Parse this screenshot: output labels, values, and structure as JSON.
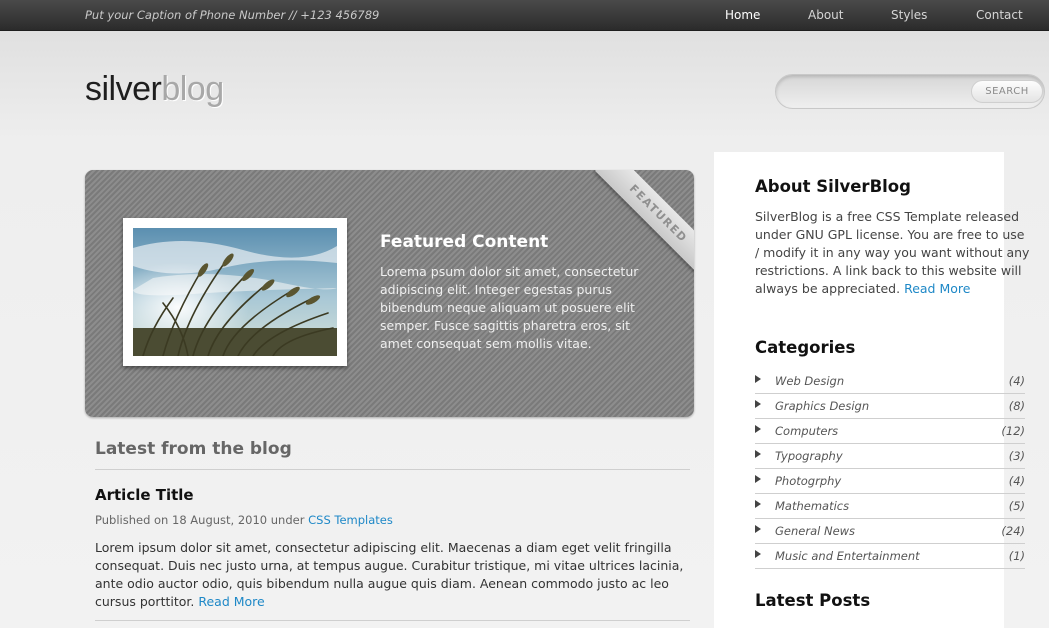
{
  "topbar": {
    "caption": "Put your Caption of Phone Number // +123 456789",
    "nav": [
      "Home",
      "About",
      "Styles",
      "Contact"
    ]
  },
  "logo": {
    "dark": "silver",
    "light": "blog"
  },
  "search": {
    "button": "SEARCH",
    "placeholder": ""
  },
  "featured": {
    "ribbon": "FEATURED",
    "title": "Featured Content",
    "text": "Lorema psum dolor sit amet, consectetur adipiscing elit. Integer egestas purus bibendum neque aliquam ut posuere elit semper. Fusce sagittis pharetra eros, sit amet consequat sem mollis vitae."
  },
  "blog": {
    "section_title": "Latest from the blog",
    "article_title": "Article Title",
    "meta_prefix": "Published on 18 August, 2010 under",
    "meta_link": "CSS Templates",
    "excerpt": "Lorem ipsum dolor sit amet, consectetur adipiscing elit. Maecenas a diam eget velit fringilla consequat. Duis nec justo urna, at tempus augue. Curabitur tristique, mi vitae ultrices lacinia, ante odio auctor odio, quis bibendum nulla augue quis diam. Aenean commodo justo ac leo cursus porttitor.",
    "read_more": "Read More"
  },
  "sidebar": {
    "about_title": "About SilverBlog",
    "about_text": "SilverBlog is a free CSS Template released under GNU GPL license. You are free to use / modify it in any way you want without any restrictions. A link back to this website will always be appreciated.",
    "about_read_more": "Read More",
    "categories_title": "Categories",
    "categories": [
      {
        "name": "Web Design",
        "count": "(4)"
      },
      {
        "name": "Graphics Design",
        "count": "(8)"
      },
      {
        "name": "Computers",
        "count": "(12)"
      },
      {
        "name": "Typography",
        "count": "(3)"
      },
      {
        "name": "Photogrphy",
        "count": "(4)"
      },
      {
        "name": "Mathematics",
        "count": "(5)"
      },
      {
        "name": "General News",
        "count": "(24)"
      },
      {
        "name": "Music and Entertainment",
        "count": "(1)"
      }
    ],
    "latest_posts_title": "Latest Posts"
  }
}
